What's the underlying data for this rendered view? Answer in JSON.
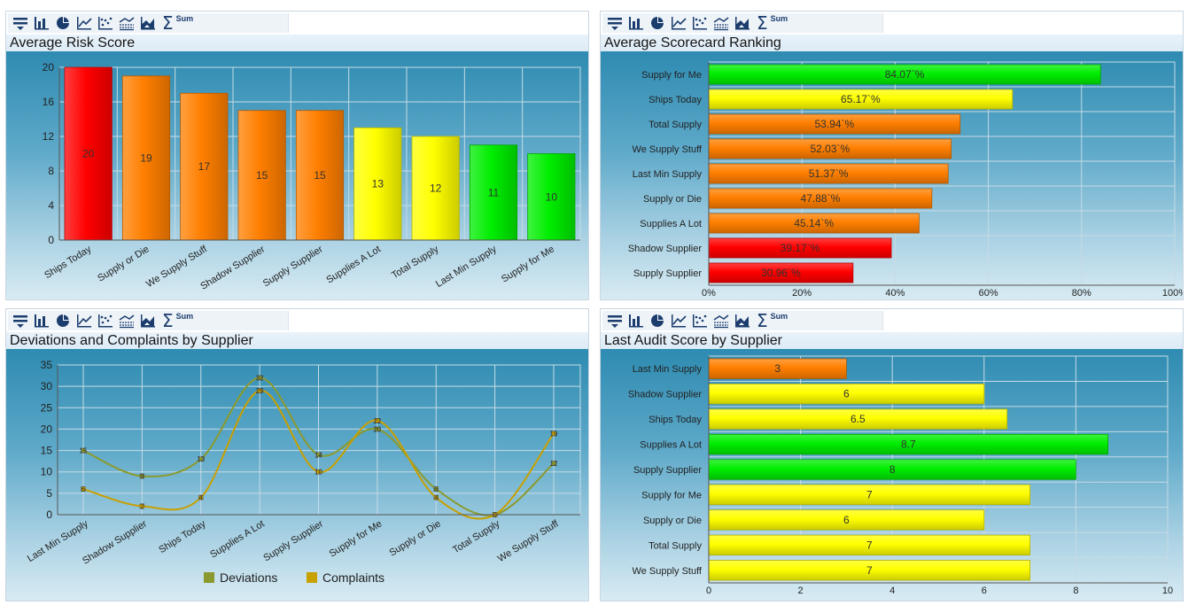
{
  "toolbar": {
    "icons": [
      "filter-icon",
      "bar-chart-icon",
      "pie-chart-icon",
      "line-chart-icon",
      "scatter-chart-icon",
      "multi-line-chart-icon",
      "area-chart-icon",
      "sigma-icon"
    ],
    "sum_label": "Sum"
  },
  "colors": {
    "red": "#ff0000",
    "orange": "#ff7f00",
    "yellow": "#ffff00",
    "green": "#00ee00",
    "deviations": "#8b9a2e",
    "complaints": "#c8a000"
  },
  "chart_data": [
    {
      "id": "risk",
      "type": "bar",
      "title": "Average Risk Score",
      "categories": [
        "Ships Today",
        "Supply or Die",
        "We Supply Stuff",
        "Shadow Supplier",
        "Supply Supplier",
        "Supplies A Lot",
        "Total Supply",
        "Last Min Supply",
        "Supply for Me"
      ],
      "values": [
        20,
        19,
        17,
        15,
        15,
        13,
        12,
        11,
        10
      ],
      "data_labels": [
        "20",
        "19",
        "17",
        "15",
        "15",
        "13",
        "12",
        "11",
        "10"
      ],
      "bar_colors": [
        "red",
        "orange",
        "orange",
        "orange",
        "orange",
        "yellow",
        "yellow",
        "green",
        "green"
      ],
      "ylim": [
        0,
        20
      ],
      "yticks": [
        "0",
        "4",
        "8",
        "12",
        "16",
        "20"
      ]
    },
    {
      "id": "scorecard",
      "type": "bar",
      "orientation": "horizontal",
      "title": "Average Scorecard Ranking",
      "categories": [
        "Supply for Me",
        "Ships Today",
        "Total Supply",
        "We Supply Stuff",
        "Last Min Supply",
        "Supply or Die",
        "Supplies A Lot",
        "Shadow Supplier",
        "Supply Supplier"
      ],
      "values": [
        84.07,
        65.17,
        53.94,
        52.03,
        51.37,
        47.88,
        45.14,
        39.17,
        30.96
      ],
      "data_labels": [
        "84.07`%",
        "65.17`%",
        "53.94`%",
        "52.03`%",
        "51.37`%",
        "47.88`%",
        "45.14`%",
        "39.17`%",
        "30.96`%"
      ],
      "bar_colors": [
        "green",
        "yellow",
        "orange",
        "orange",
        "orange",
        "orange",
        "orange",
        "red",
        "red"
      ],
      "xlim": [
        0,
        100
      ],
      "xticks": [
        "0%",
        "20%",
        "40%",
        "60%",
        "80%",
        "100%"
      ]
    },
    {
      "id": "deviations",
      "type": "line",
      "title": "Deviations and Complaints by Supplier",
      "categories": [
        "Last Min Supply",
        "Shadow Supplier",
        "Ships Today",
        "Supplies A Lot",
        "Supply Supplier",
        "Supply for Me",
        "Supply or Die",
        "Total Supply",
        "We Supply Stuff"
      ],
      "series": [
        {
          "name": "Deviations",
          "values": [
            15,
            9,
            13,
            32,
            14,
            20,
            6,
            0,
            12
          ]
        },
        {
          "name": "Complaints",
          "values": [
            6,
            2,
            4,
            29,
            10,
            22,
            4,
            0,
            19
          ]
        }
      ],
      "ylim": [
        0,
        35
      ],
      "yticks": [
        "0",
        "5",
        "10",
        "15",
        "20",
        "25",
        "30",
        "35"
      ],
      "legend": "bottom"
    },
    {
      "id": "audit",
      "type": "bar",
      "orientation": "horizontal",
      "title": "Last Audit Score by Supplier",
      "categories": [
        "Last Min Supply",
        "Shadow Supplier",
        "Ships Today",
        "Supplies A Lot",
        "Supply Supplier",
        "Supply for Me",
        "Supply or Die",
        "Total Supply",
        "We Supply Stuff"
      ],
      "values": [
        3,
        6,
        6.5,
        8.7,
        8,
        7,
        6,
        7,
        7
      ],
      "data_labels": [
        "3",
        "6",
        "6.5",
        "8.7",
        "8",
        "7",
        "6",
        "7",
        "7"
      ],
      "bar_colors": [
        "orange",
        "yellow",
        "yellow",
        "green",
        "green",
        "yellow",
        "yellow",
        "yellow",
        "yellow"
      ],
      "xlim": [
        0,
        10
      ],
      "xticks": [
        "0",
        "2",
        "4",
        "6",
        "8",
        "10"
      ]
    }
  ]
}
